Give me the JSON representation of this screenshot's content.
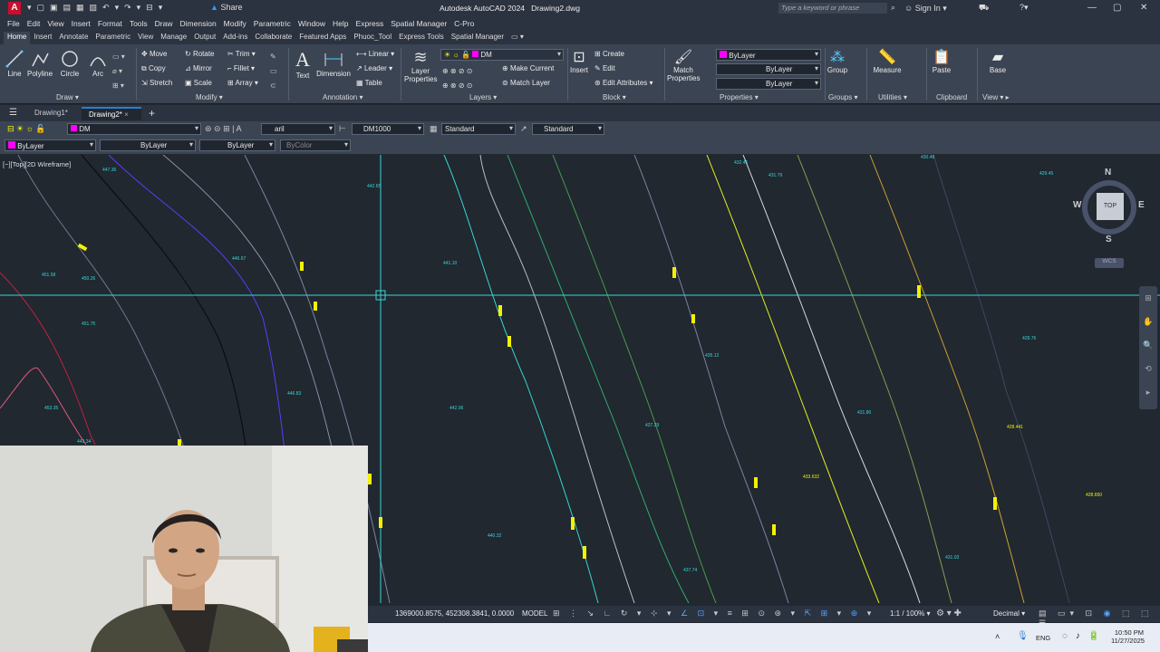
{
  "title": {
    "app": "Autodesk AutoCAD 2024",
    "file": "Drawing2.dwg",
    "search_placeholder": "Type a keyword or phrase",
    "signin": "Sign In",
    "share": "Share"
  },
  "menu": [
    "File",
    "Edit",
    "View",
    "Insert",
    "Format",
    "Tools",
    "Draw",
    "Dimension",
    "Modify",
    "Parametric",
    "Window",
    "Help",
    "Express",
    "Spatial Manager",
    "C-Pro"
  ],
  "ribbon_tabs": [
    "Home",
    "Insert",
    "Annotate",
    "Parametric",
    "View",
    "Manage",
    "Output",
    "Add-ins",
    "Collaborate",
    "Featured Apps",
    "Phuoc_Tool",
    "Express Tools",
    "Spatial Manager"
  ],
  "ribbon": {
    "draw": {
      "line": "Line",
      "polyline": "Polyline",
      "circle": "Circle",
      "arc": "Arc",
      "panel": "Draw"
    },
    "modify": {
      "move": "Move",
      "rotate": "Rotate",
      "trim": "Trim",
      "copy": "Copy",
      "mirror": "Mirror",
      "fillet": "Fillet",
      "stretch": "Stretch",
      "scale": "Scale",
      "array": "Array",
      "panel": "Modify"
    },
    "annotation": {
      "text": "Text",
      "dimension": "Dimension",
      "linear": "Linear",
      "leader": "Leader",
      "table": "Table",
      "panel": "Annotation"
    },
    "layers": {
      "layer_properties": "Layer Properties",
      "layer_name": "DM",
      "make_current": "Make Current",
      "match_layer": "Match Layer",
      "panel": "Layers"
    },
    "block": {
      "insert": "Insert",
      "create": "Create",
      "edit": "Edit",
      "edit_attributes": "Edit Attributes",
      "panel": "Block"
    },
    "properties": {
      "match": "Match Properties",
      "color": "ByLayer",
      "linetype": "ByLayer",
      "lineweight": "ByLayer",
      "panel": "Properties"
    },
    "groups": {
      "group": "Group",
      "panel": "Groups"
    },
    "utilities": {
      "measure": "Measure",
      "panel": "Utilities"
    },
    "clipboard": {
      "paste": "Paste",
      "panel": "Clipboard"
    },
    "view": {
      "base": "Base",
      "panel": "View"
    }
  },
  "doc_tabs": [
    "Drawing1*",
    "Drawing2*"
  ],
  "toolbar1": {
    "layer": "DM",
    "text_style": "aril",
    "dim_style": "DM1000",
    "table_style": "Standard",
    "mleader_style": "Standard"
  },
  "toolbar2": {
    "color": "ByLayer",
    "linetype": "ByLayer",
    "lineweight": "ByLayer",
    "plotstyle": "ByColor"
  },
  "viewport": {
    "label": "[−][Top][2D Wireframe]",
    "compass": {
      "n": "N",
      "s": "S",
      "e": "E",
      "w": "W",
      "top": "TOP",
      "wcs": "WCS"
    }
  },
  "labels": {
    "cyan": [
      "447.36",
      "442.65",
      "441.10",
      "451.58",
      "450.26",
      "446.67",
      "451.75",
      "453.35",
      "446.83",
      "442.06",
      "443.34",
      "440.32",
      "437.29",
      "435.12",
      "431.80",
      "431.03",
      "432.41",
      "431.79",
      "430.48",
      "429.45",
      "428.76",
      "437.74"
    ],
    "yellow": [
      "433.632",
      "428.441",
      "428.650"
    ]
  },
  "status": {
    "coords": "1369000.8575, 452308.3841, 0.0000",
    "model": "MODEL",
    "scale": "1:1 / 100%",
    "units": "Decimal"
  },
  "taskbar": {
    "lang": "ENG",
    "time": "10:50 PM",
    "date": "11/27/2025"
  },
  "colors": {
    "bg": "#212830",
    "cyan": "#36d6d6",
    "yellow": "#f2f200",
    "accent": "#2a7fd4"
  }
}
